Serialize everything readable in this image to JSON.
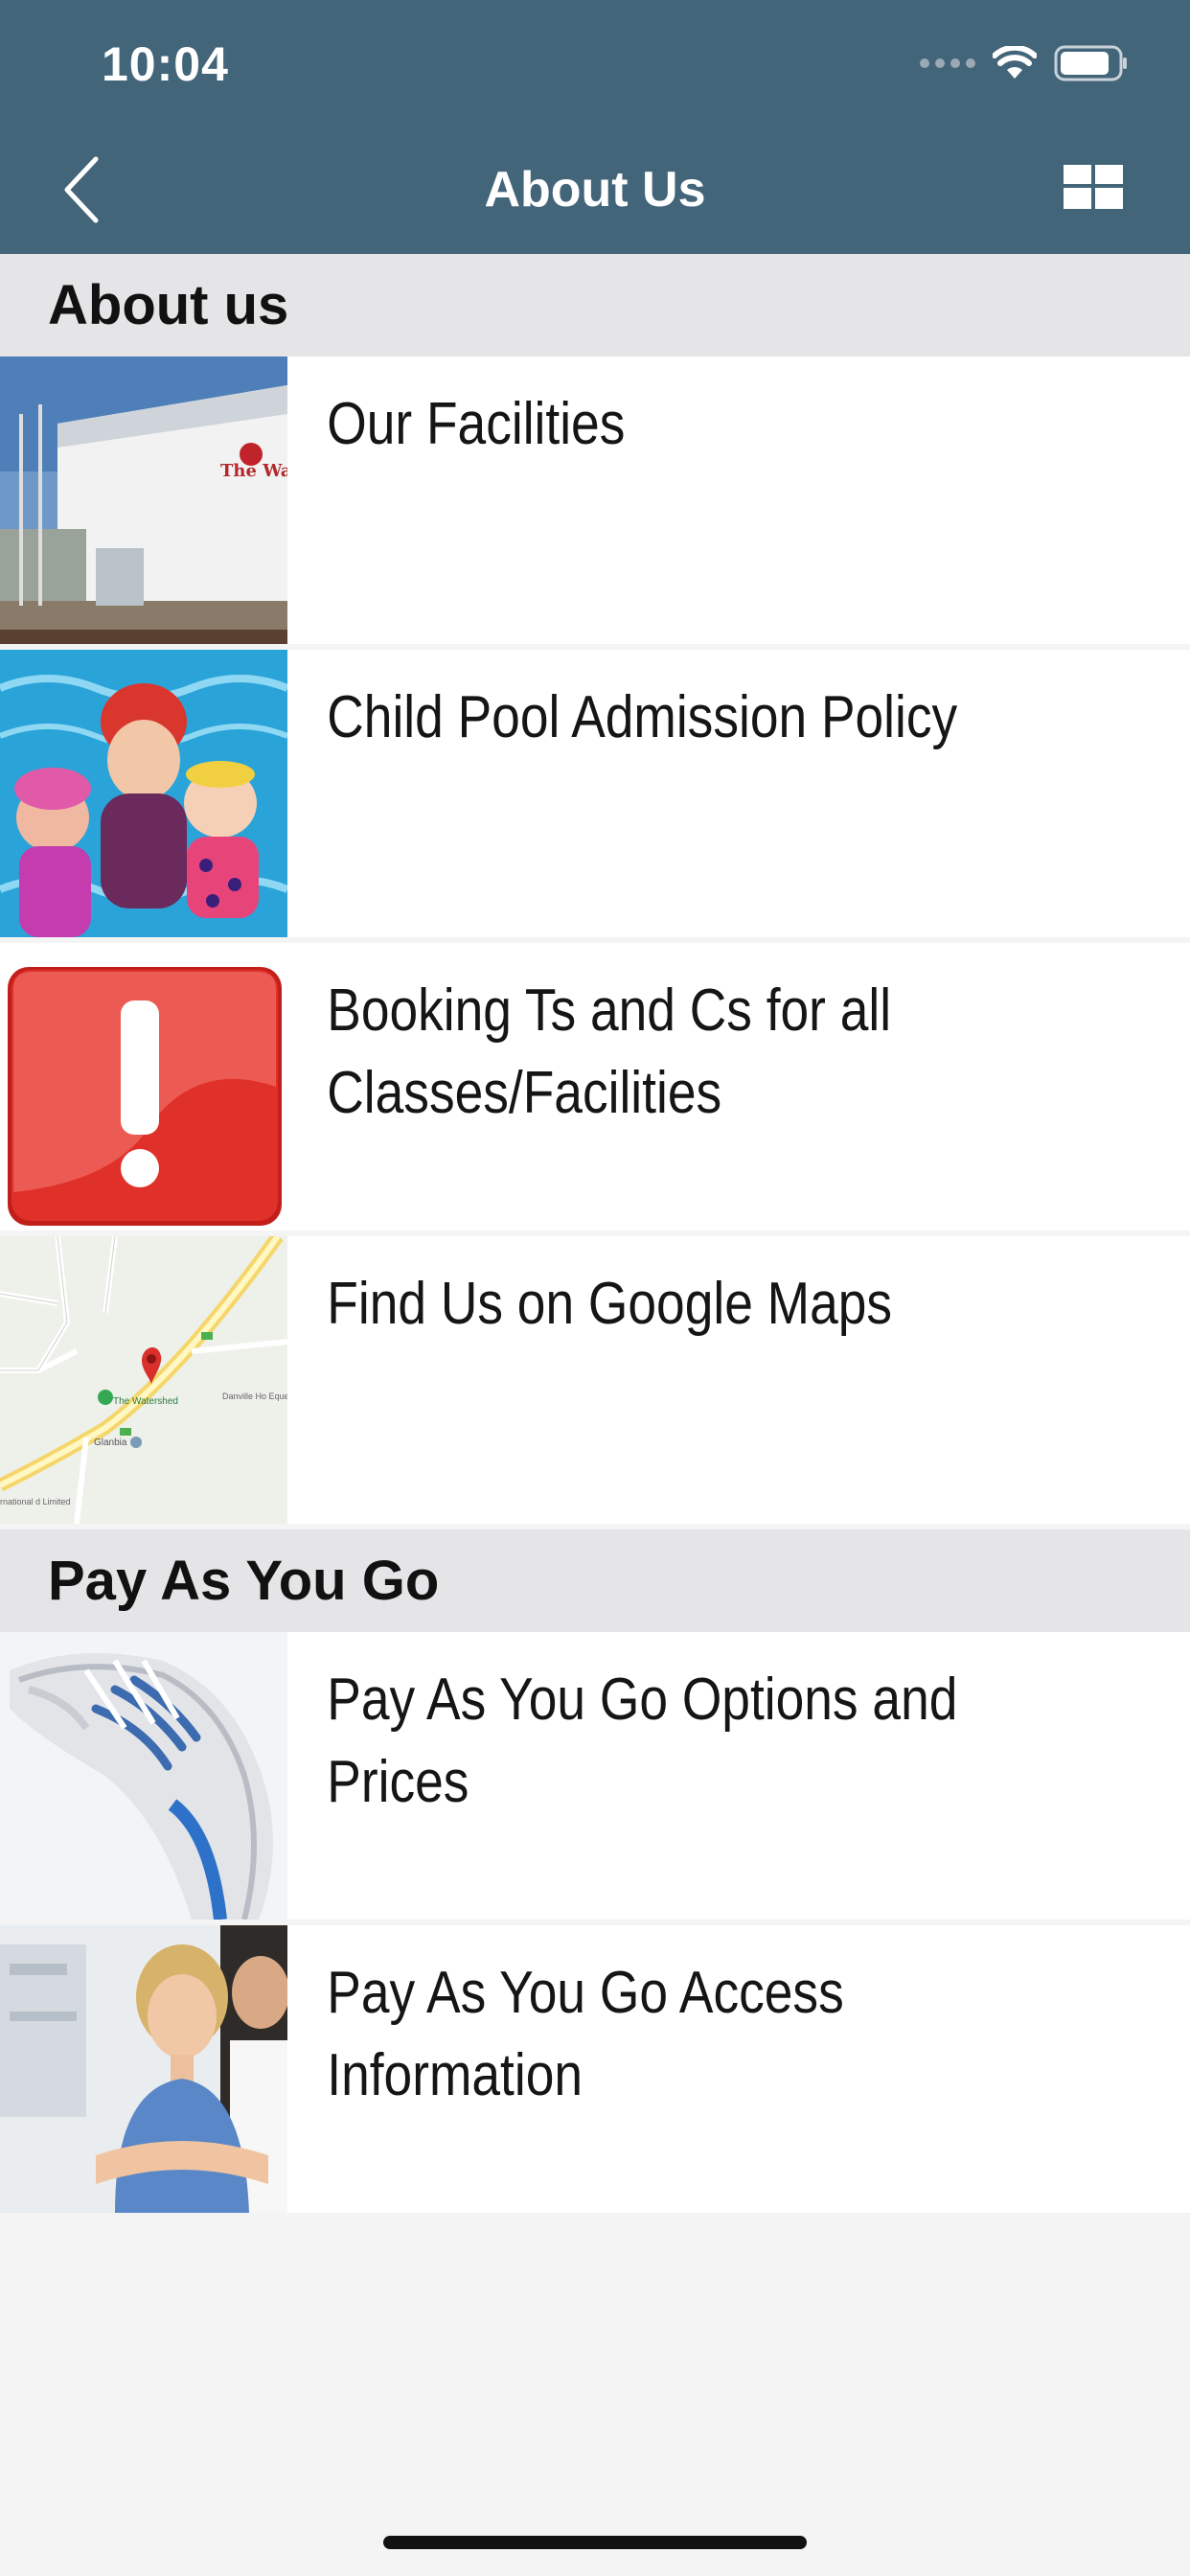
{
  "status_bar": {
    "time": "10:04"
  },
  "nav": {
    "title": "About Us",
    "back_icon": "chevron-left-icon",
    "grid_icon": "grid-view-icon"
  },
  "sections": [
    {
      "title": "About us",
      "items": [
        {
          "label": "Our Facilities",
          "thumb": "building"
        },
        {
          "label": "Child Pool Admission Policy",
          "thumb": "pool"
        },
        {
          "label": "Booking Ts and Cs for all Classes/Facilities",
          "thumb": "alert"
        },
        {
          "label": "Find Us on Google Maps",
          "thumb": "map"
        }
      ]
    },
    {
      "title": "Pay As You Go",
      "items": [
        {
          "label": "Pay As You Go Options and Prices",
          "thumb": "shoe"
        },
        {
          "label": "Pay As You Go Access Information",
          "thumb": "people"
        }
      ]
    }
  ],
  "map_labels": {
    "place": "The Watershed",
    "town": "Glanbia",
    "equestrian": "Danville Ho Equestrian an",
    "corner": "rnational d Limited"
  },
  "building_sign": "The Watershed",
  "colors": {
    "header": "#436579",
    "section": "#e5e5e7",
    "background": "#f4f4f4",
    "alert_red": "#e0302a"
  }
}
